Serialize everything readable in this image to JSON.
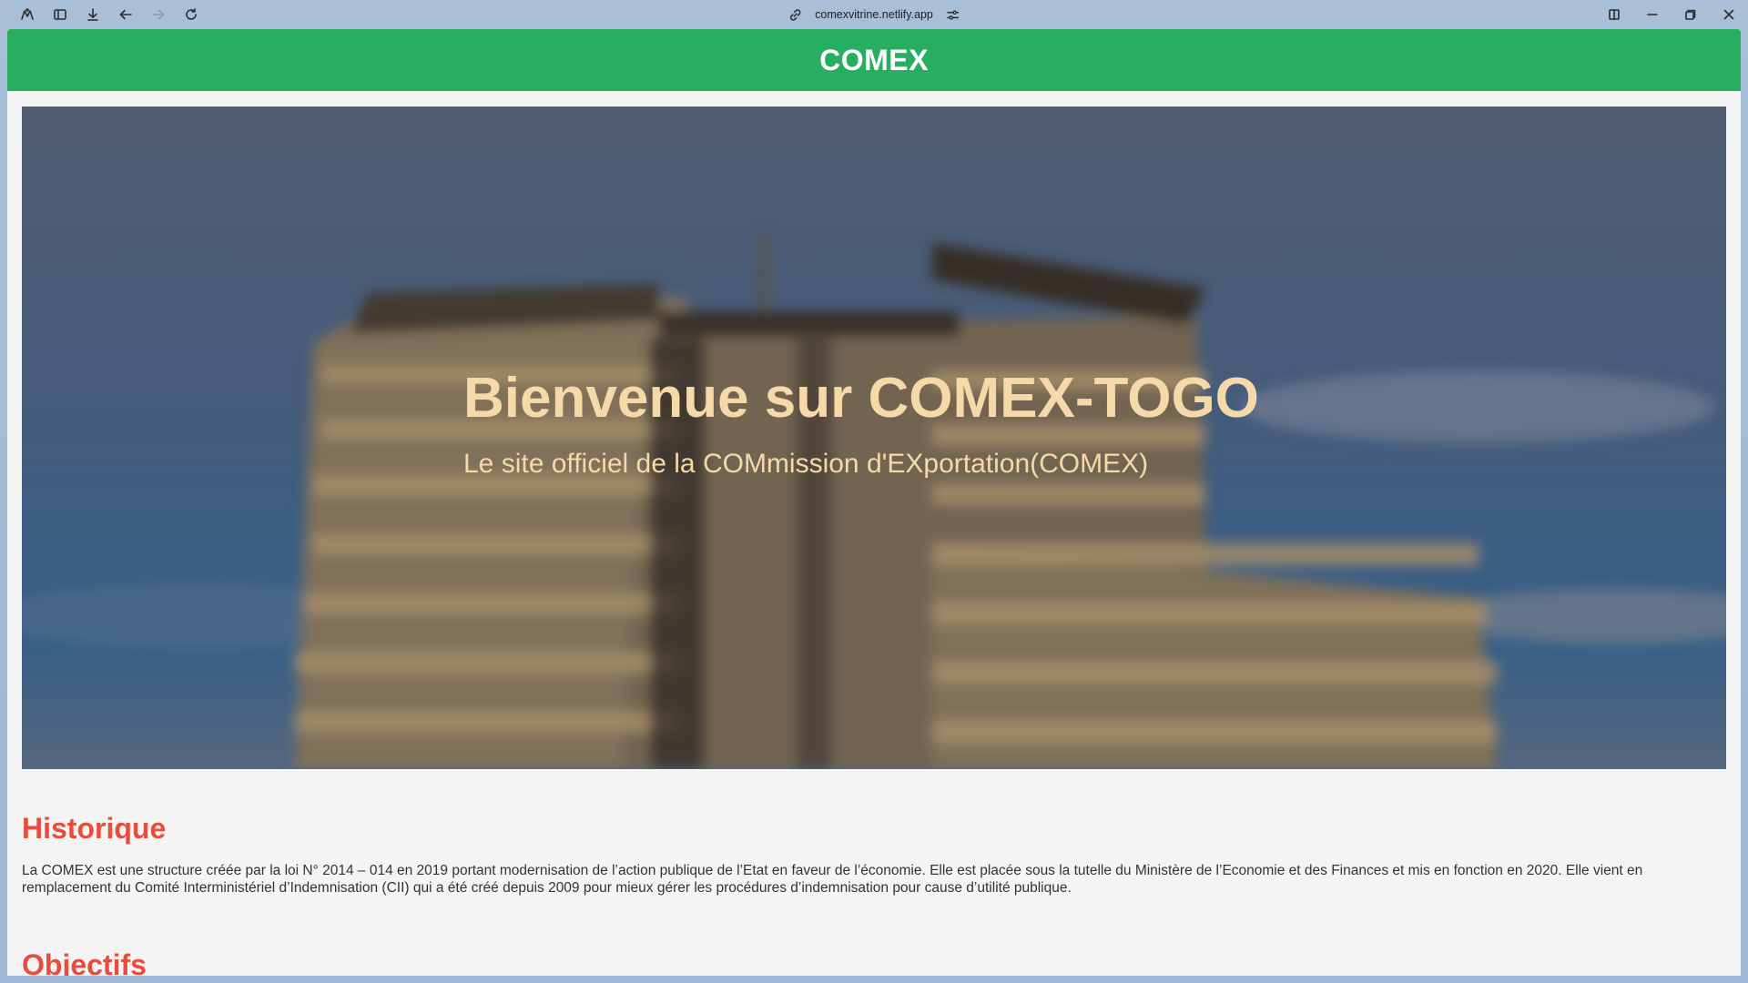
{
  "browser": {
    "url": "comexvitrine.netlify.app"
  },
  "header": {
    "title": "COMEX"
  },
  "hero": {
    "title": "Bienvenue sur COMEX-TOGO",
    "subtitle": "Le site officiel de la COMmission d'EXportation(COMEX)"
  },
  "sections": [
    {
      "heading": "Historique",
      "body": "La COMEX est une structure créée par la loi N° 2014 – 014 en 2019 portant modernisation de l’action publique de l’Etat en faveur de l’économie. Elle est placée sous la tutelle du Ministère de l’Economie et des Finances et mis en fonction en 2020. Elle vient en remplacement du Comité Interministériel d’Indemnisation (CII) qui a été créé depuis 2009 pour mieux gérer les procédures d’indemnisation pour cause d’utilité publique."
    },
    {
      "heading": "Objectifs"
    }
  ],
  "colors": {
    "header_bg": "#27ae60",
    "section_heading": "#e74c3c",
    "hero_text": "#f6d9a8",
    "page_bg": "#f4f4f4"
  }
}
